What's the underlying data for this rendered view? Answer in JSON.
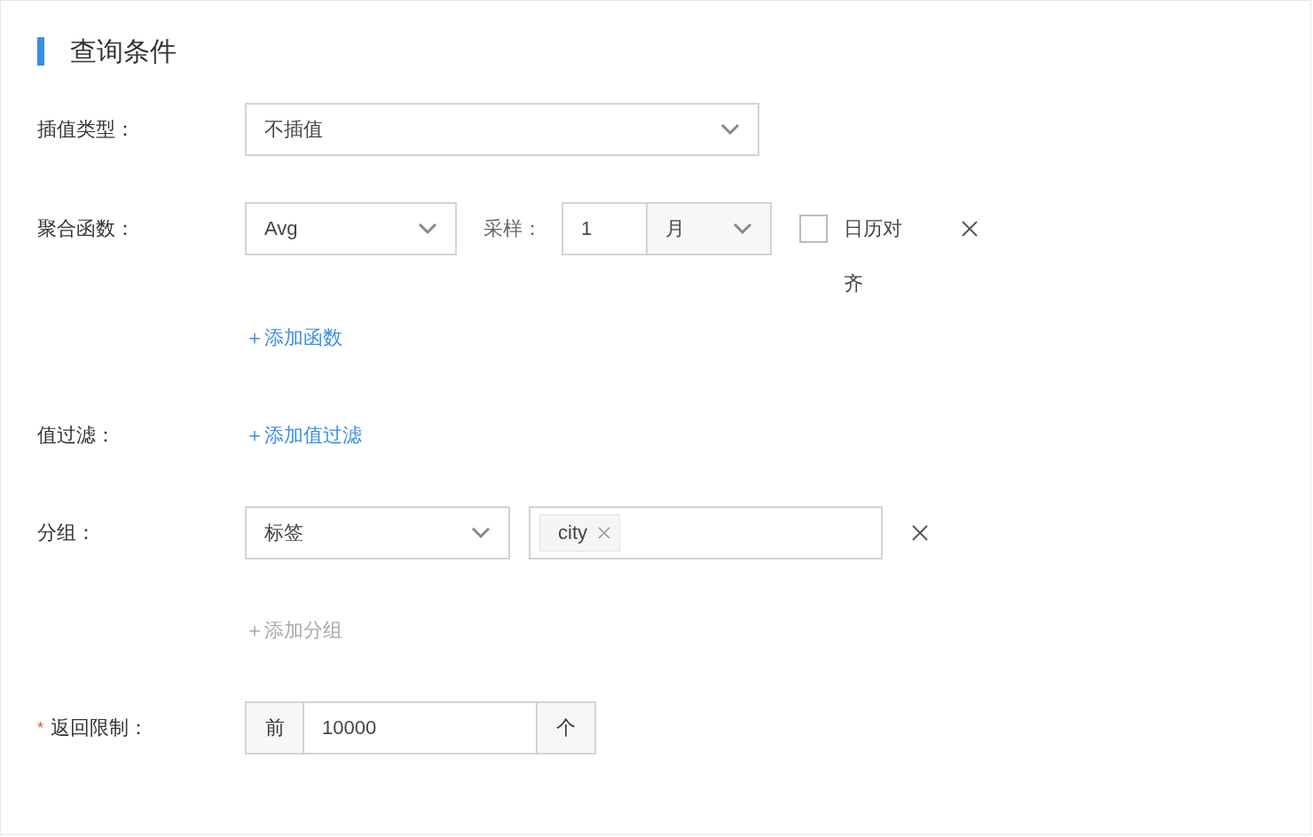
{
  "section_title": "查询条件",
  "interpolation": {
    "label": "插值类型：",
    "value": "不插值"
  },
  "aggregation": {
    "label": "聚合函数：",
    "function": "Avg",
    "sampling_label": "采样：",
    "sampling_value": "1",
    "sampling_unit": "月",
    "calendar_align": {
      "label": "日历对齐",
      "checked": false
    },
    "add_link": {
      "text": "＋添加函数",
      "disabled": false
    }
  },
  "value_filter": {
    "label": "值过滤：",
    "add_link": {
      "text": "＋添加值过滤",
      "disabled": false
    }
  },
  "group": {
    "label": "分组：",
    "type": "标签",
    "tags": [
      "city"
    ],
    "add_link": {
      "text": "＋添加分组",
      "disabled": true
    }
  },
  "limit": {
    "label": "返回限制：",
    "required_mark": "*",
    "prefix": "前",
    "value": "10000",
    "suffix": "个"
  }
}
